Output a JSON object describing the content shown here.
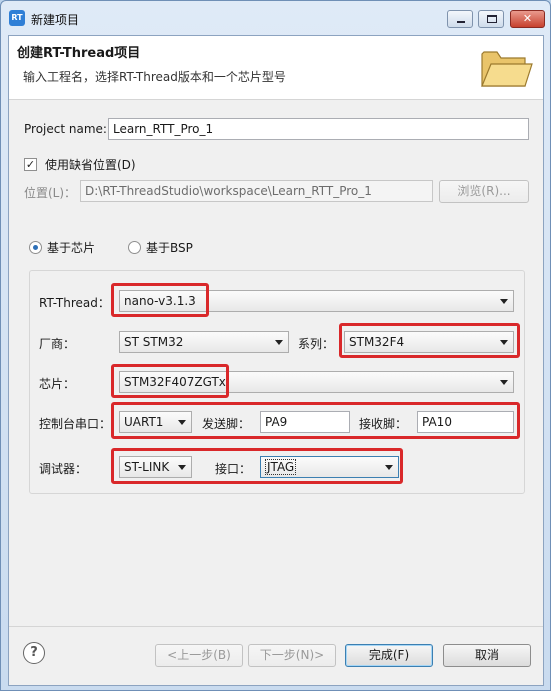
{
  "window": {
    "title": "新建项目",
    "app_icon_text": "RT",
    "close_glyph": "✕"
  },
  "banner": {
    "title": "创建RT-Thread项目",
    "description": "输入工程名，选择RT-Thread版本和一个芯片型号"
  },
  "project": {
    "name_label": "Project name:",
    "name_value": "Learn_RTT_Pro_1"
  },
  "location": {
    "use_default_label": "使用缺省位置(D)",
    "use_default_checked": "✓",
    "location_label": "位置(L)：",
    "location_value": "D:\\RT-ThreadStudio\\workspace\\Learn_RTT_Pro_1",
    "browse_label": "浏览(R)..."
  },
  "mode": {
    "chip_label": "基于芯片",
    "bsp_label": "基于BSP"
  },
  "fields": {
    "rtthread_label": "RT-Thread：",
    "rtthread_value": "nano-v3.1.3",
    "vendor_label": "厂商：",
    "vendor_value": "ST STM32",
    "series_label": "系列：",
    "series_value": "STM32F4",
    "chip_label": "芯片：",
    "chip_value": "STM32F407ZGTx",
    "console_label": "控制台串口：",
    "console_value": "UART1",
    "tx_label": "发送脚：",
    "tx_value": "PA9",
    "rx_label": "接收脚：",
    "rx_value": "PA10",
    "debugger_label": "调试器：",
    "debugger_value": "ST-LINK",
    "interface_label": "接口：",
    "interface_value": "JTAG"
  },
  "footer": {
    "help_glyph": "?",
    "back_label": "<上一步(B)",
    "next_label": "下一步(N)>",
    "finish_label": "完成(F)",
    "cancel_label": "取消"
  },
  "colors": {
    "highlight_red": "#d9282a",
    "accent_blue": "#3c7fb1"
  }
}
